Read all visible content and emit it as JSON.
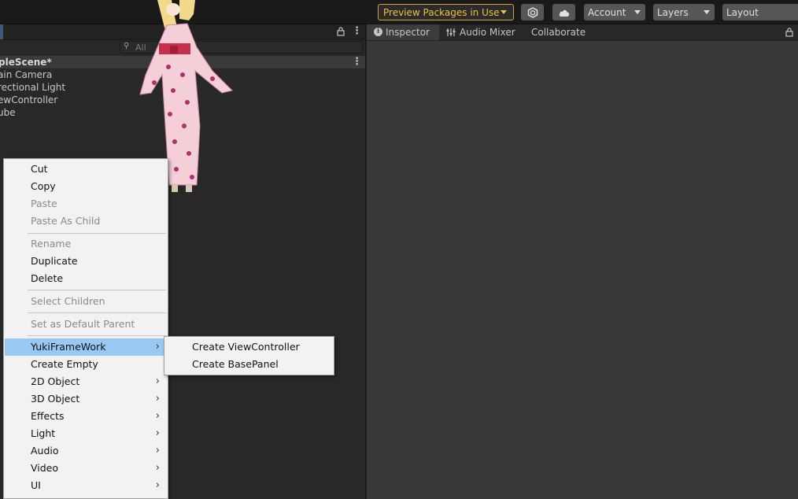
{
  "toolbar": {
    "preview_packages": "Preview Packages in Use",
    "account": "Account",
    "layers": "Layers",
    "layout": "Layout",
    "icons": {
      "package_manager": "package-icon",
      "cloud": "cloud-icon"
    },
    "accent_color": "#f0c040"
  },
  "hierarchy": {
    "search_placeholder": "All",
    "scene_name": "pleScene*",
    "items": [
      "ain Camera",
      "rectional Light",
      "ewController",
      "ube"
    ]
  },
  "inspector": {
    "tabs": [
      "Inspector",
      "Audio Mixer",
      "Collaborate"
    ]
  },
  "context_menu": {
    "items": {
      "cut": "Cut",
      "copy": "Copy",
      "paste": "Paste",
      "paste_as_child": "Paste As Child",
      "rename": "Rename",
      "duplicate": "Duplicate",
      "delete": "Delete",
      "select_children": "Select Children",
      "set_default_parent": "Set as Default Parent",
      "yuki": "YukiFrameWork",
      "create_empty": "Create Empty",
      "obj2d": "2D Object",
      "obj3d": "3D Object",
      "effects": "Effects",
      "light": "Light",
      "audio": "Audio",
      "video": "Video",
      "ui": "UI"
    },
    "highlight_color": "#99c8f2",
    "submenu": {
      "create_viewcontroller": "Create ViewController",
      "create_basepanel": "Create BasePanel"
    }
  }
}
